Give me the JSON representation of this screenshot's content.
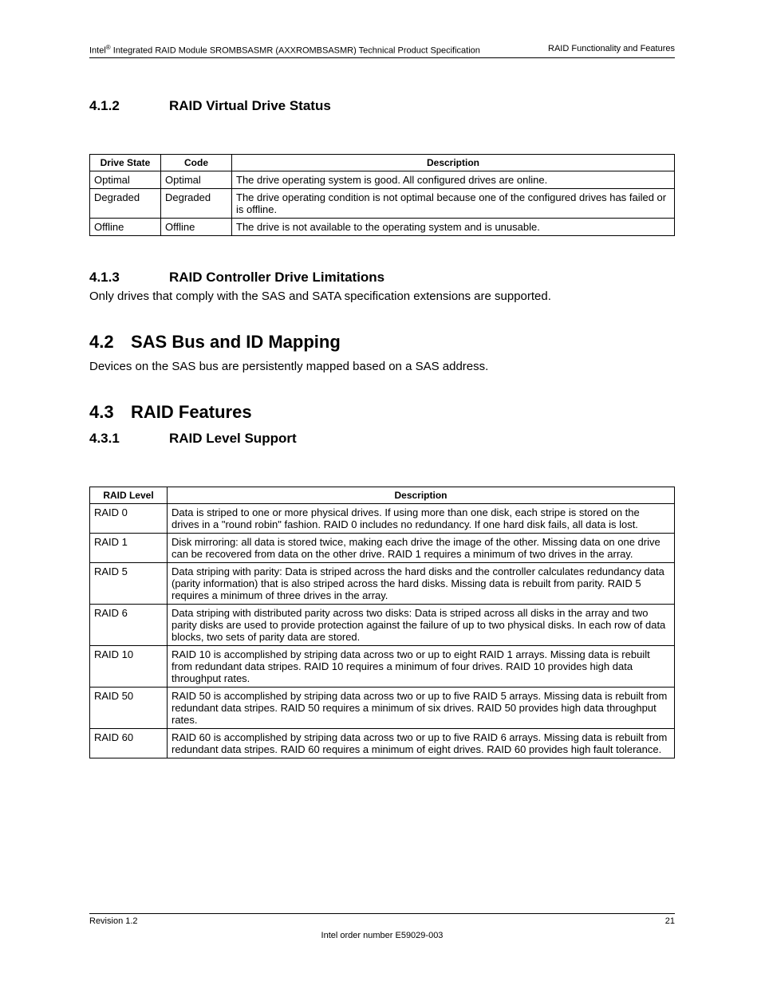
{
  "header": {
    "left_pre": "Intel",
    "left_sup": "®",
    "left_post": " Integrated RAID Module SROMBSASMR (AXXROMBSASMR) Technical Product Specification",
    "right": "RAID Functionality and Features"
  },
  "sections": {
    "s412": {
      "num": "4.1.2",
      "title": "RAID Virtual Drive Status"
    },
    "s413": {
      "num": "4.1.3",
      "title": "RAID Controller Drive Limitations",
      "body": "Only drives that comply with the SAS and SATA specification extensions are supported."
    },
    "s42": {
      "num": "4.2",
      "title": "SAS Bus and ID Mapping",
      "body": "Devices on the SAS bus are persistently mapped based on a SAS address."
    },
    "s43": {
      "num": "4.3",
      "title": "RAID Features"
    },
    "s431": {
      "num": "4.3.1",
      "title": "RAID Level Support"
    }
  },
  "table1": {
    "headers": [
      "Drive State",
      "Code",
      "Description"
    ],
    "rows": [
      [
        "Optimal",
        "Optimal",
        "The drive operating system is good. All configured drives are online."
      ],
      [
        "Degraded",
        "Degraded",
        "The drive operating condition is not optimal because one of the configured drives has failed or is offline."
      ],
      [
        "Offline",
        "Offline",
        "The drive is not available to the operating system and is unusable."
      ]
    ]
  },
  "table2": {
    "headers": [
      "RAID Level",
      "Description"
    ],
    "rows": [
      [
        "RAID 0",
        "Data is striped to one or more physical drives. If using more than one disk, each stripe is stored on the drives in a \"round robin\" fashion. RAID 0 includes no redundancy. If one hard disk fails, all data is lost."
      ],
      [
        "RAID 1",
        "Disk mirroring: all data is stored twice, making each drive the image of the other. Missing data on one drive can be recovered from data on the other drive. RAID 1 requires a minimum of two drives in the array."
      ],
      [
        "RAID 5",
        "Data striping with parity: Data is striped across the hard disks and the controller calculates redundancy data (parity information) that is also striped across the hard disks. Missing data is rebuilt from parity. RAID 5 requires a minimum of three drives in the array."
      ],
      [
        "RAID 6",
        "Data striping with distributed parity across two disks: Data is striped across all disks in the array and two parity disks are used to provide protection against the failure of up to two physical disks. In each row of data blocks, two sets of parity data are stored."
      ],
      [
        "RAID 10",
        "RAID 10 is accomplished by striping data across two or up to eight RAID 1 arrays. Missing data is rebuilt from redundant data stripes. RAID 10 requires a minimum of four drives. RAID 10 provides high data throughput rates."
      ],
      [
        "RAID 50",
        "RAID 50 is accomplished by striping data across two or up to five RAID 5 arrays. Missing data is rebuilt from redundant data stripes. RAID 50 requires a minimum of six drives. RAID 50 provides high data throughput rates."
      ],
      [
        "RAID 60",
        "RAID 60 is accomplished by striping data across two or up to five RAID 6 arrays. Missing data is rebuilt from redundant data stripes. RAID 60 requires a minimum of eight drives. RAID 60 provides high fault tolerance."
      ]
    ]
  },
  "footer": {
    "revision": "Revision 1.2",
    "page": "21",
    "order": "Intel order number E59029-003"
  }
}
